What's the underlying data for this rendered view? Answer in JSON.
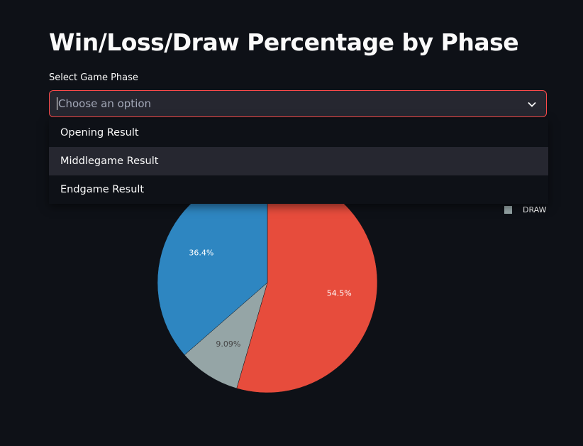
{
  "page": {
    "title": "Win/Loss/Draw Percentage by Phase"
  },
  "select": {
    "label": "Select Game Phase",
    "placeholder": "Choose an option",
    "options": [
      {
        "label": "Opening Result"
      },
      {
        "label": "Middlegame Result"
      },
      {
        "label": "Endgame Result"
      }
    ],
    "highlighted_option": "Middlegame Result",
    "accent_color": "#ff4b4b",
    "chevron_icon": "chevron-down-icon"
  },
  "chart_data": {
    "type": "pie",
    "title": "",
    "series": [
      {
        "label": "",
        "value": 54.5,
        "text": "54.5%",
        "color": "#e74c3c"
      },
      {
        "label": "DRAW",
        "value": 9.09,
        "text": "9.09%",
        "color": "#95a5a6"
      },
      {
        "label": "",
        "value": 36.4,
        "text": "36.4%",
        "color": "#2e86c1"
      }
    ],
    "legend": {
      "placement": "top-right",
      "visible_entries": [
        "DRAW"
      ]
    }
  }
}
